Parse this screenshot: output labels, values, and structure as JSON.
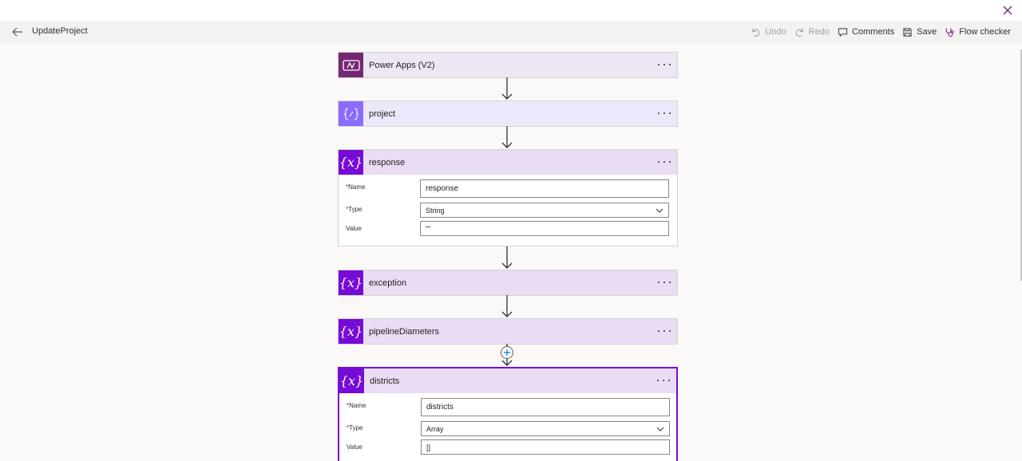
{
  "window": {
    "close_icon": "close-icon"
  },
  "header": {
    "flow_name": "UpdateProject",
    "back_icon": "arrow-left-icon",
    "actions": {
      "undo": "Undo",
      "redo": "Redo",
      "comments": "Comments",
      "save": "Save",
      "flow_checker": "Flow checker"
    }
  },
  "colors": {
    "trigger_icon_bg": "#742774",
    "compose_icon_bg": "#8c6cff",
    "variable_icon_bg": "#770bd6",
    "selected_border": "#770bd6",
    "required_marker": "#a4262c"
  },
  "steps": [
    {
      "title": "Power Apps (V2)",
      "icon": "powerapps-icon"
    },
    {
      "title": "project",
      "icon": "compose-icon"
    },
    {
      "title": "response",
      "icon": "variable-icon",
      "fields": {
        "name_label": "Name",
        "name_value": "response",
        "type_label": "Type",
        "type_value": "String",
        "value_label": "Value",
        "value_value": "\"\""
      }
    },
    {
      "title": "exception",
      "icon": "variable-icon"
    },
    {
      "title": "pipelineDiameters",
      "icon": "variable-icon"
    },
    {
      "title": "districts",
      "icon": "variable-icon",
      "selected": true,
      "fields": {
        "name_label": "Name",
        "name_value": "districts",
        "type_label": "Type",
        "type_value": "Array",
        "value_label": "Value",
        "value_value": "[]"
      }
    }
  ],
  "required_marker": "*",
  "insert_step_icon": "plus-icon"
}
